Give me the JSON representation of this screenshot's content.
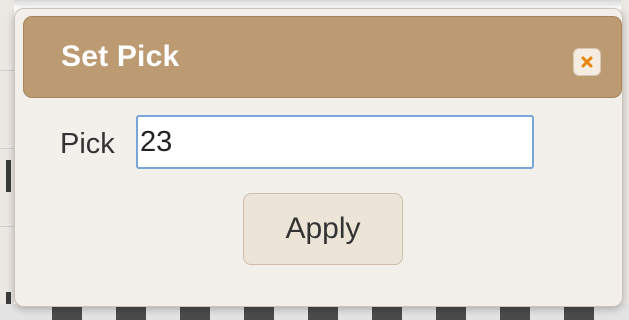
{
  "dialog": {
    "title": "Set Pick",
    "close_icon": "close-icon"
  },
  "form": {
    "pick_label": "Pick",
    "pick_value": "23"
  },
  "actions": {
    "apply_label": "Apply"
  },
  "colors": {
    "titlebar": "#bc9a72",
    "close_x": "#e8850f",
    "dialog_bg": "#f3f0ec",
    "input_border": "#7aa5d8",
    "button_bg": "#ede4d8"
  }
}
